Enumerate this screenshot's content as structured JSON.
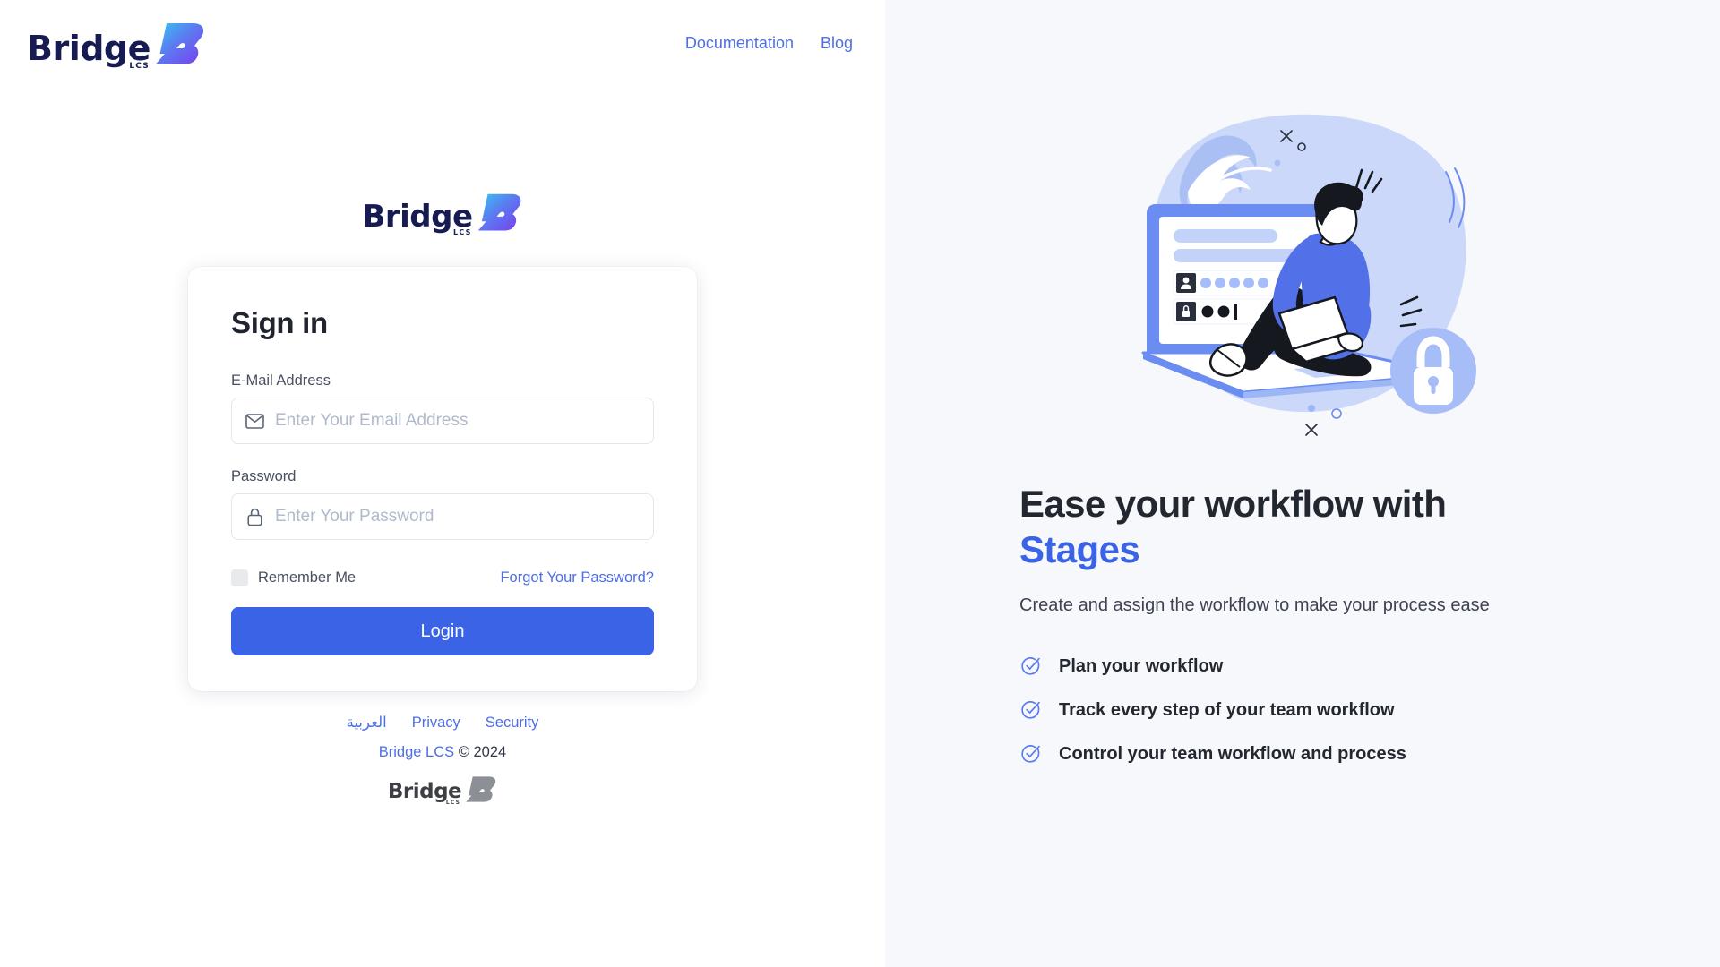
{
  "brand": {
    "name": "Bridge",
    "sub": "LCS",
    "logo_icon": "bridge-lcs-logo"
  },
  "topnav": {
    "links": [
      {
        "label": "Documentation"
      },
      {
        "label": "Blog"
      }
    ]
  },
  "signin_card": {
    "title": "Sign in",
    "email": {
      "label": "E-Mail Address",
      "placeholder": "Enter Your Email Address",
      "value": "",
      "icon": "envelope-icon"
    },
    "password": {
      "label": "Password",
      "placeholder": "Enter Your Password",
      "value": "",
      "icon": "lock-icon"
    },
    "remember_me": {
      "label": "Remember Me",
      "checked": false
    },
    "forgot_password": "Forgot Your Password?",
    "submit": "Login"
  },
  "footer": {
    "links": [
      {
        "label": "العربية"
      },
      {
        "label": "Privacy"
      },
      {
        "label": "Security"
      }
    ],
    "copyright_brand": "Bridge LCS",
    "copyright_rest": " © 2024",
    "logo_icon": "bridge-lcs-logo-gray"
  },
  "promo": {
    "illustration": "person-working-on-laptop-login-security-illustration",
    "title_line1": "Ease your workflow with",
    "title_line2": "Stages",
    "subtitle": "Create and assign the workflow to make your process ease",
    "features": [
      {
        "icon": "check-circle-icon",
        "label": "Plan your workflow"
      },
      {
        "icon": "check-circle-icon",
        "label": "Track every step of your team workflow"
      },
      {
        "icon": "check-circle-icon",
        "label": "Control your team workflow and process"
      }
    ]
  },
  "colors": {
    "accent_blue": "#3b63e6",
    "link_blue": "#4d6ee8",
    "panel_bg": "#f7f8fc",
    "logo_navy": "#161b52",
    "feature_icon": "#5b7cf0"
  }
}
